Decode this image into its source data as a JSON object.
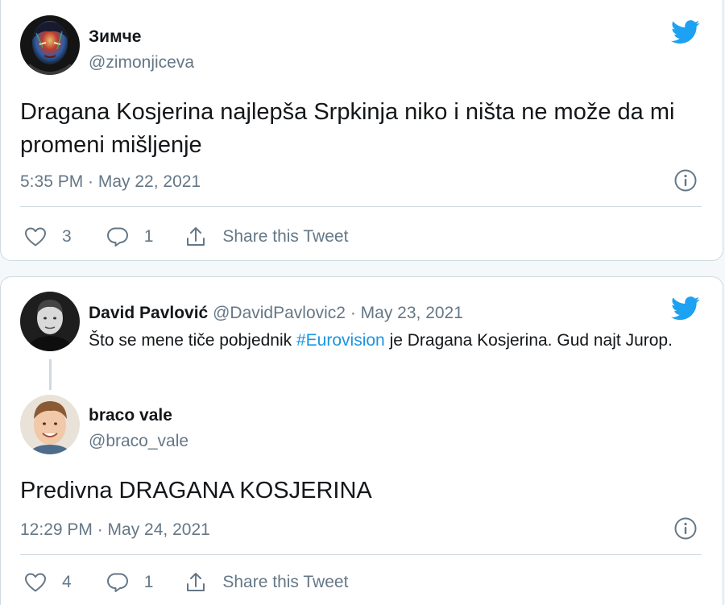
{
  "tweet1": {
    "author_name": "Зимче",
    "author_handle": "@zimonjiceva",
    "text": "Dragana Kosjerina najlepša Srpkinja niko i ništa ne može da mi promeni mišljenje",
    "timestamp": "5:35 PM · May 22, 2021",
    "likes": "3",
    "replies": "1",
    "share_label": "Share this Tweet"
  },
  "tweet2": {
    "parent": {
      "author_name": "David Pavlović",
      "author_handle": "@DavidPavlovic2",
      "separator": " · ",
      "date": "May 23, 2021",
      "text_before": "Što se mene tiče pobjednik ",
      "hashtag": "#Eurovision",
      "text_after": " je Dragana Kosjerina. Gud najt Jurop."
    },
    "reply": {
      "author_name": "braco vale",
      "author_handle": "@braco_vale",
      "text": "Predivna DRAGANA KOSJERINA",
      "timestamp": "12:29 PM · May 24, 2021",
      "likes": "4",
      "replies": "1",
      "share_label": "Share this Tweet"
    }
  },
  "colors": {
    "twitter_blue": "#1da1f2",
    "hashtag": "#1b95e0",
    "muted": "#657786",
    "border": "#cfd9de"
  },
  "icons": [
    "twitter-bird-icon",
    "info-icon",
    "heart-icon",
    "reply-bubble-icon",
    "share-icon"
  ]
}
